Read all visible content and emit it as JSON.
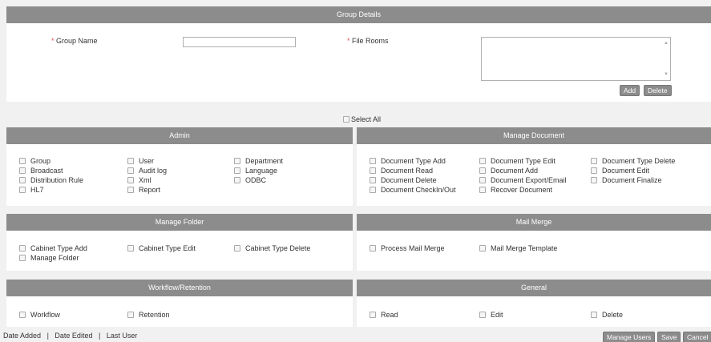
{
  "group_details": {
    "header": "Group Details",
    "group_name_label": "Group Name",
    "group_name_value": "",
    "file_rooms_label": "File Rooms",
    "required_marker": "*",
    "add_button": "Add",
    "delete_button": "Delete"
  },
  "select_all": "Select All",
  "sections": {
    "admin": {
      "title": "Admin",
      "items": [
        "Group",
        "Broadcast",
        "Distribution Rule",
        "HL7",
        "User",
        "Audit log",
        "Xml",
        "Report",
        "Department",
        "Language",
        "ODBC"
      ]
    },
    "manage_document": {
      "title": "Manage Document",
      "items": [
        "Document Type Add",
        "Document Read",
        "Document Delete",
        "Document CheckIn/Out",
        "Document Type Edit",
        "Document Add",
        "Document Export/Email",
        "Recover Document",
        "Document Type Delete",
        "Document Edit",
        "Document Finalize"
      ]
    },
    "manage_folder": {
      "title": "Manage Folder",
      "items": [
        "Cabinet Type Add",
        "Manage Folder",
        "Cabinet Type Edit",
        "Cabinet Type Delete"
      ]
    },
    "mail_merge": {
      "title": "Mail Merge",
      "items": [
        "Process Mail Merge",
        "Mail Merge Template"
      ]
    },
    "workflow": {
      "title": "Workflow/Retention",
      "items": [
        "Workflow",
        "Retention"
      ]
    },
    "general": {
      "title": "General",
      "items": [
        "Read",
        "Edit",
        "Delete"
      ]
    }
  },
  "footer": {
    "date_added": "Date Added",
    "date_edited": "Date Edited",
    "last_user": "Last User",
    "separator": "|",
    "manage_users_button": "Manage Users",
    "save_button": "Save",
    "cancel_button": "Cancel"
  },
  "colors": {
    "header_bar": "#8c8c8c",
    "required": "#d9534f",
    "background": "#f1f1f1"
  }
}
